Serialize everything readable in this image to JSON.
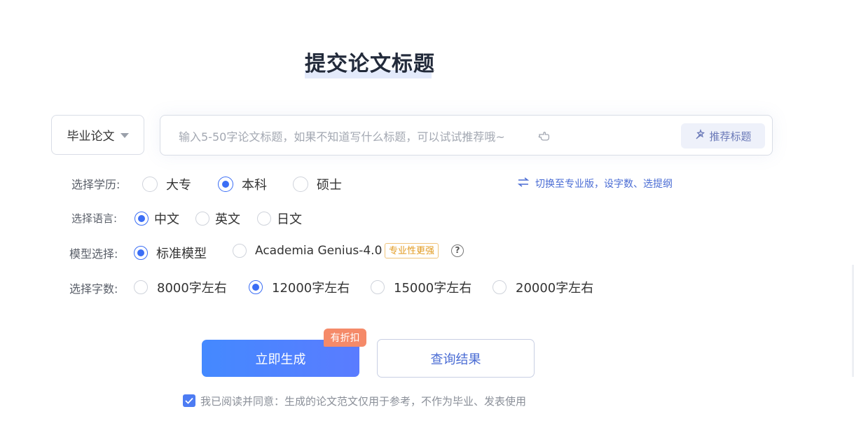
{
  "page": {
    "title": "提交论文标题"
  },
  "paper_type": {
    "selected": "毕业论文"
  },
  "title_input": {
    "placeholder": "输入5-50字论文标题，如果不知道写什么标题，可以试试推荐哦~",
    "value": ""
  },
  "recommend_button": {
    "label": "推荐标题"
  },
  "switch_link": {
    "label": "切换至专业版，设字数、选提纲"
  },
  "education": {
    "label": "选择学历:",
    "options": [
      "大专",
      "本科",
      "硕士"
    ],
    "selected": "本科"
  },
  "language": {
    "label": "选择语言:",
    "options": [
      "中文",
      "英文",
      "日文"
    ],
    "selected": "中文"
  },
  "model": {
    "label": "模型选择:",
    "options": [
      "标准模型",
      "Academia Genius-4.0"
    ],
    "selected": "标准模型",
    "pro_badge": "专业性更强",
    "help": "?"
  },
  "word_count": {
    "label": "选择字数:",
    "options": [
      "8000字左右",
      "12000字左右",
      "15000字左右",
      "20000字左右"
    ],
    "selected": "12000字左右"
  },
  "actions": {
    "generate_label": "立即生成",
    "discount_badge": "有折扣",
    "query_label": "查询结果"
  },
  "agreement": {
    "checked": true,
    "text": "我已阅读并同意：生成的论文范文仅用于参考，不作为毕业、发表使用"
  },
  "colors": {
    "accent": "#3b6ef5",
    "primary_button": "#4489ff",
    "discount": "#f58a69",
    "pro_badge": "#e29a1f"
  },
  "icons": {
    "type_caret": "chevron-down-icon",
    "hand": "pointing-hand-icon",
    "recommend": "magic-wand-icon",
    "switch": "swap-arrows-icon",
    "help": "question-circle-icon",
    "agree": "checkbox-checked-icon"
  }
}
